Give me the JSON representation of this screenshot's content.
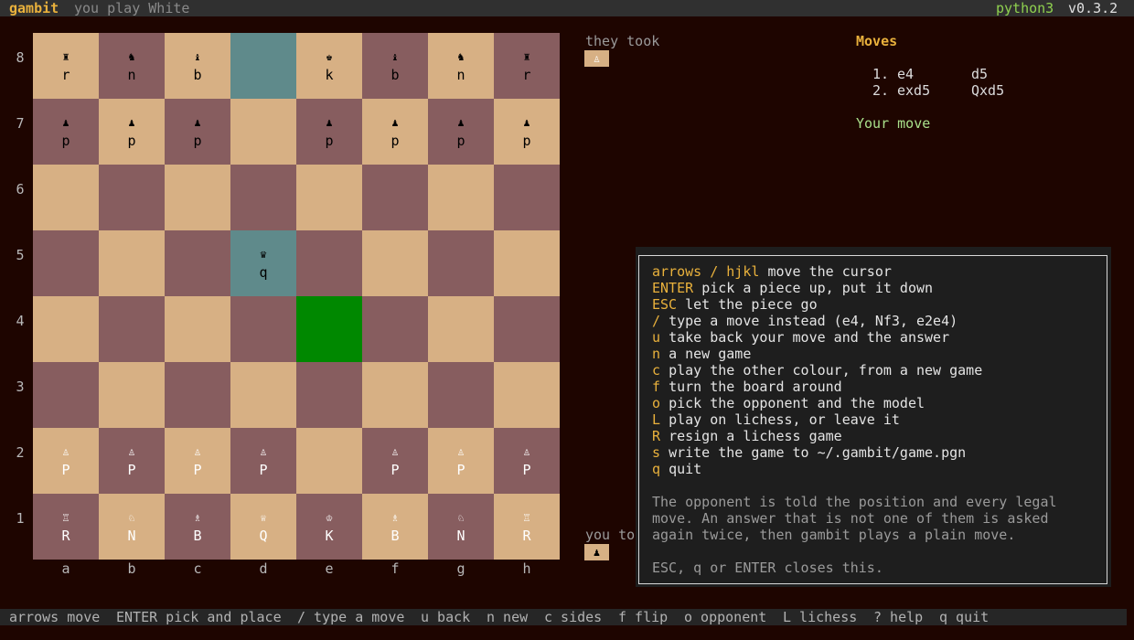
{
  "header": {
    "app_name": "gambit",
    "subtitle": "you play White",
    "runtime": "python3",
    "version": "v0.3.2"
  },
  "board": {
    "ranks": [
      "8",
      "7",
      "6",
      "5",
      "4",
      "3",
      "2",
      "1"
    ],
    "files": [
      "a",
      "b",
      "c",
      "d",
      "e",
      "f",
      "g",
      "h"
    ],
    "rows": [
      [
        {
          "g": "♜",
          "l": "r"
        },
        {
          "g": "♞",
          "l": "n"
        },
        {
          "g": "♝",
          "l": "b"
        },
        {
          "g": "",
          "l": ""
        },
        {
          "g": "♚",
          "l": "k"
        },
        {
          "g": "♝",
          "l": "b"
        },
        {
          "g": "♞",
          "l": "n"
        },
        {
          "g": "♜",
          "l": "r"
        }
      ],
      [
        {
          "g": "♟",
          "l": "p"
        },
        {
          "g": "♟",
          "l": "p"
        },
        {
          "g": "♟",
          "l": "p"
        },
        {
          "g": "",
          "l": ""
        },
        {
          "g": "♟",
          "l": "p"
        },
        {
          "g": "♟",
          "l": "p"
        },
        {
          "g": "♟",
          "l": "p"
        },
        {
          "g": "♟",
          "l": "p"
        }
      ],
      [
        {
          "g": "",
          "l": ""
        },
        {
          "g": "",
          "l": ""
        },
        {
          "g": "",
          "l": ""
        },
        {
          "g": "",
          "l": ""
        },
        {
          "g": "",
          "l": ""
        },
        {
          "g": "",
          "l": ""
        },
        {
          "g": "",
          "l": ""
        },
        {
          "g": "",
          "l": ""
        }
      ],
      [
        {
          "g": "",
          "l": ""
        },
        {
          "g": "",
          "l": ""
        },
        {
          "g": "",
          "l": ""
        },
        {
          "g": "♛",
          "l": "q"
        },
        {
          "g": "",
          "l": ""
        },
        {
          "g": "",
          "l": ""
        },
        {
          "g": "",
          "l": ""
        },
        {
          "g": "",
          "l": ""
        }
      ],
      [
        {
          "g": "",
          "l": ""
        },
        {
          "g": "",
          "l": ""
        },
        {
          "g": "",
          "l": ""
        },
        {
          "g": "",
          "l": ""
        },
        {
          "g": "",
          "l": ""
        },
        {
          "g": "",
          "l": ""
        },
        {
          "g": "",
          "l": ""
        },
        {
          "g": "",
          "l": ""
        }
      ],
      [
        {
          "g": "",
          "l": ""
        },
        {
          "g": "",
          "l": ""
        },
        {
          "g": "",
          "l": ""
        },
        {
          "g": "",
          "l": ""
        },
        {
          "g": "",
          "l": ""
        },
        {
          "g": "",
          "l": ""
        },
        {
          "g": "",
          "l": ""
        },
        {
          "g": "",
          "l": ""
        }
      ],
      [
        {
          "g": "♙",
          "l": "P"
        },
        {
          "g": "♙",
          "l": "P"
        },
        {
          "g": "♙",
          "l": "P"
        },
        {
          "g": "♙",
          "l": "P"
        },
        {
          "g": "",
          "l": ""
        },
        {
          "g": "♙",
          "l": "P"
        },
        {
          "g": "♙",
          "l": "P"
        },
        {
          "g": "♙",
          "l": "P"
        }
      ],
      [
        {
          "g": "♖",
          "l": "R"
        },
        {
          "g": "♘",
          "l": "N"
        },
        {
          "g": "♗",
          "l": "B"
        },
        {
          "g": "♕",
          "l": "Q"
        },
        {
          "g": "♔",
          "l": "K"
        },
        {
          "g": "♗",
          "l": "B"
        },
        {
          "g": "♘",
          "l": "N"
        },
        {
          "g": "♖",
          "l": "R"
        }
      ]
    ],
    "highlights": [
      "d8",
      "d5"
    ],
    "cursor": "e4",
    "colors": {
      "light": "#d7b084",
      "dark": "#875d5f",
      "highlight": "#5f8a8b",
      "cursor": "#008800"
    }
  },
  "captured": {
    "they_label": "they took",
    "they": "♙",
    "you_label": "you to",
    "you": "♟"
  },
  "moves": {
    "title": "Moves",
    "list": [
      {
        "num": "1.",
        "white": "e4",
        "black": "d5"
      },
      {
        "num": "2.",
        "white": "exd5",
        "black": "Qxd5"
      }
    ],
    "status": "Your move"
  },
  "help": {
    "lines": [
      {
        "key": "arrows / hjkl",
        "desc": "move the cursor"
      },
      {
        "key": "ENTER",
        "desc": "pick a piece up, put it down"
      },
      {
        "key": "ESC",
        "desc": "let the piece go"
      },
      {
        "key": "/",
        "desc": "type a move instead (e4, Nf3, e2e4)"
      },
      {
        "key": "u",
        "desc": "take back your move and the answer"
      },
      {
        "key": "n",
        "desc": "a new game"
      },
      {
        "key": "c",
        "desc": "play the other colour, from a new game"
      },
      {
        "key": "f",
        "desc": "turn the board around"
      },
      {
        "key": "o",
        "desc": "pick the opponent and the model"
      },
      {
        "key": "L",
        "desc": "play on lichess, or leave it"
      },
      {
        "key": "R",
        "desc": "resign a lichess game"
      },
      {
        "key": "s",
        "desc": "write the game to ~/.gambit/game.pgn"
      },
      {
        "key": "q",
        "desc": "quit"
      }
    ],
    "note": [
      "The opponent is told the position and every legal",
      "move. An answer that is not one of them is asked",
      "again twice, then gambit plays a plain move."
    ],
    "close_hint": "ESC, q or ENTER closes this."
  },
  "footer": {
    "items": [
      {
        "key": "arrows",
        "desc": "move"
      },
      {
        "key": "ENTER",
        "desc": "pick and place"
      },
      {
        "key": "/",
        "desc": "type a move"
      },
      {
        "key": "u",
        "desc": "back"
      },
      {
        "key": "n",
        "desc": "new"
      },
      {
        "key": "c",
        "desc": "sides"
      },
      {
        "key": "f",
        "desc": "flip"
      },
      {
        "key": "o",
        "desc": "opponent"
      },
      {
        "key": "L",
        "desc": "lichess"
      },
      {
        "key": "?",
        "desc": "help"
      },
      {
        "key": "q",
        "desc": "quit"
      }
    ]
  }
}
